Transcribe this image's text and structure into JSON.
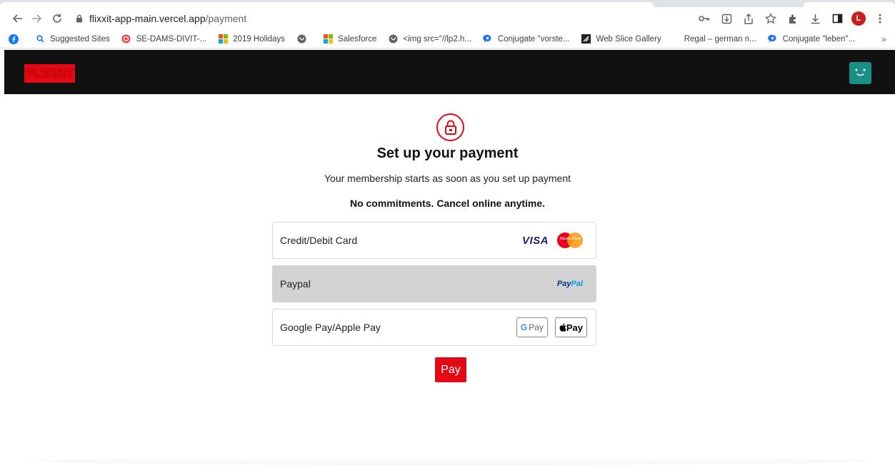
{
  "browser": {
    "url_host": "flixxit-app-main.vercel.app",
    "url_path": "/payment",
    "profile_initial": "L",
    "bookmarks": [
      {
        "label": "",
        "icon": "facebook-icon",
        "color": "#1877f2"
      },
      {
        "label": "Suggested Sites",
        "icon": "search-icon",
        "color": "#1a73e8"
      },
      {
        "label": "SE-DAMS-DIVIT-...",
        "icon": "app-icon",
        "color": "#e8453c"
      },
      {
        "label": "2019 Holidays",
        "icon": "microsoft-icon",
        "color": "#f25022"
      },
      {
        "label": "",
        "icon": "globe-icon",
        "color": "#5f6368"
      },
      {
        "label": "Salesforce",
        "icon": "microsoft-icon",
        "color": "#f25022"
      },
      {
        "label": "<img src=\"//lp2.h...",
        "icon": "globe-icon",
        "color": "#5f6368"
      },
      {
        "label": "Conjugate \"vorste...",
        "icon": "chat-icon",
        "color": "#1a73e8"
      },
      {
        "label": "Web Slice Gallery",
        "icon": "slice-icon",
        "color": "#202124"
      },
      {
        "label": "Regal – german n...",
        "icon": "none",
        "color": ""
      },
      {
        "label": "Conjugate \"leben\"...",
        "icon": "chat-icon",
        "color": "#1a73e8"
      }
    ],
    "bookmarks_more": "»"
  },
  "app": {
    "logo": "FLIXXIT",
    "accent": "#e50914",
    "avatar_color": "#1a8f86"
  },
  "payment": {
    "title": "Set up your payment",
    "subtitle": "Your membership starts as soon as you set up payment",
    "commitment": "No commitments. Cancel online anytime.",
    "options": [
      {
        "label": "Credit/Debit Card",
        "selected": false,
        "brands": [
          "VISA",
          "MasterCard"
        ]
      },
      {
        "label": "Paypal",
        "selected": true,
        "brands": [
          "PayPal"
        ]
      },
      {
        "label": "Google Pay/Apple Pay",
        "selected": false,
        "brands": [
          "G Pay",
          "Pay"
        ]
      }
    ],
    "visa": "VISA",
    "mastercard": "MasterCard",
    "paypal_pay": "Pay",
    "paypal_pal": "Pal",
    "gpay_g": "G",
    "gpay_text": "Pay",
    "apay_text": "Pay",
    "pay_button": "Pay"
  }
}
